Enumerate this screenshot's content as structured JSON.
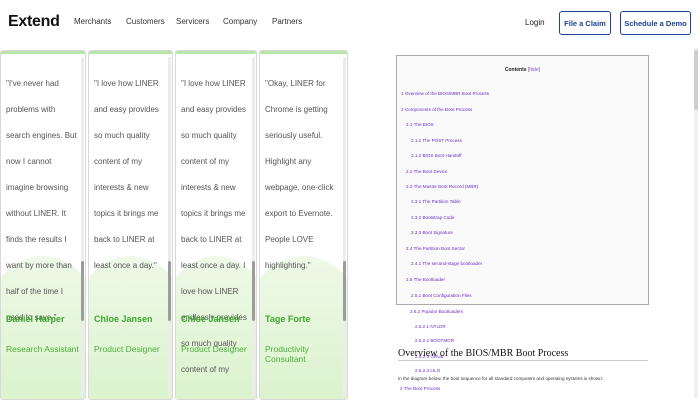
{
  "header": {
    "logo": "Extend",
    "nav": [
      "Merchants",
      "Customers",
      "Servicers",
      "Company",
      "Partners"
    ],
    "login": "Login",
    "file_claim": "File a Claim",
    "schedule_demo": "Schedule a Demo"
  },
  "testimonials": [
    {
      "quote": "\"I've never had problems with search engines. But now I cannot imagine browsing without LINER. It finds the results I want by more than half of the time I used to save.\"",
      "name": "Daniel Harper",
      "role": "Research Assistant"
    },
    {
      "quote": "\"I love how LINER and easy provides so much quality content of my interests & new topics it brings me back to LINER at least once a day.\"",
      "name": "Chloe Jansen",
      "role": "Product Designer"
    },
    {
      "quote": "\"I love how LINER and easy provides so much quality content of my interests & new topics it brings me back to LINER at least once a day. I love how LINER endlessly provides so much quality content of my",
      "name": "Chloe Jansen",
      "role": "Product Designer"
    },
    {
      "quote": "\"Okay, LINER for Chrome is getting seriously useful. Highlight any webpage, one-click export to Evernote. People LOVE highlighting.\"",
      "name": "Tage Forte",
      "role": "Productivity Consultant"
    }
  ],
  "toc": {
    "title": "Contents",
    "hide": "[hide]",
    "items": [
      "1 Overview of the BIOS/MBR Boot Process",
      "2 Components of the Boot Process",
      "2.1 The BIOS",
      "2.1.1 The POST Process",
      "2.1.2 BIOS Boot Handoff",
      "2.2 The Boot Device",
      "2.3 The Master Boot Record (MBR)",
      "2.3.1 The Partition Table",
      "2.3.2 Bootstrap Code",
      "2.3.3 Boot Signature",
      "2.4 The Partition Boot Sector",
      "2.4.1 The second-stage bootloader",
      "2.5 The Bootloader",
      "2.5.1 Boot Configuration Files"
    ],
    "overflow_items": [
      "2.5.2 Popular Bootloaders",
      "2.5.2.1 NTLDR",
      "2.5.2.2 BOOTMGR",
      "2.5.2.3 GRUB",
      "2.5.2.4 LILO"
    ]
  },
  "article": {
    "heading": "Overview of the BIOS/MBR Boot Process",
    "paragraph": "In the diagram below, the boot sequence for all standard computers and operating systems is shown:",
    "link": "2 The Boot Process"
  }
}
